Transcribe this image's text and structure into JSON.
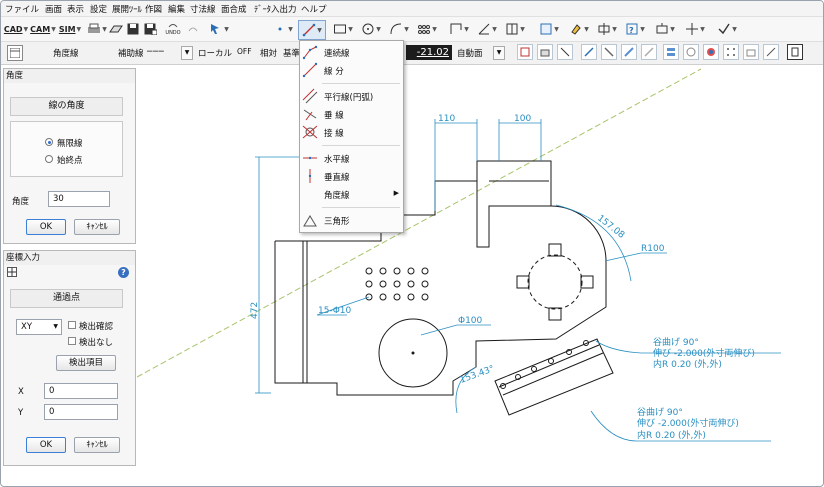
{
  "menubar": {
    "items": [
      "ファイル",
      "画面",
      "表示",
      "設定",
      "展開ﾂｰﾙ",
      "作図",
      "編集",
      "寸法線",
      "面合成",
      "ﾃﾞｰﾀ入出力",
      "ヘルプ"
    ]
  },
  "toolbar1": {
    "cad_label": "CAD",
    "cam_label": "CAM",
    "sim_label": "SIM",
    "undo_label": "UNDO"
  },
  "toolbar2": {
    "view_label": "角度線",
    "line_type": "補助線",
    "coord_system": "ローカル",
    "snap_state": "OFF",
    "relative_label": "相対",
    "base_label": "基準",
    "dimension_value": "-21.02",
    "plane_label": "自動面"
  },
  "line_menu": {
    "items": [
      {
        "label": "連続線",
        "icon": "polyline-icon"
      },
      {
        "label": "線 分",
        "icon": "segment-icon"
      },
      {
        "label": "平行線(円弧)",
        "icon": "parallel-line-icon"
      },
      {
        "label": "垂 線",
        "icon": "perpendicular-icon"
      },
      {
        "label": "接 線",
        "icon": "tangent-icon"
      },
      {
        "label": "水平線",
        "icon": "horizontal-line-icon"
      },
      {
        "label": "垂直線",
        "icon": "vertical-line-icon"
      },
      {
        "label": "角度線",
        "icon": "angle-line-icon",
        "has_submenu": true
      },
      {
        "label": "三角形",
        "icon": "triangle-icon"
      }
    ]
  },
  "angle_panel": {
    "title": "角度",
    "header": "線の角度",
    "option_infinite": "無限線",
    "option_endpoint": "始終点",
    "selected_option": "無限線",
    "angle_label": "角度",
    "angle_value": "30",
    "ok_label": "OK",
    "cancel_label": "ｷｬﾝｾﾙ"
  },
  "coord_panel": {
    "title": "座標入力",
    "help_label": "?",
    "passpoint_label": "通過点",
    "mode_value": "XY",
    "check_confirm": "検出確認",
    "check_none": "検出なし",
    "detect_button": "検出項目",
    "x_label": "X",
    "x_value": "0",
    "y_label": "Y",
    "y_value": "0",
    "ok_label": "OK",
    "cancel_label": "ｷｬﾝｾﾙ"
  },
  "drawing": {
    "dims": {
      "dim_110": "110",
      "dim_100": "100",
      "dim_472": "472",
      "dim_157": "157.08",
      "radius": "R100",
      "holes": "15-Φ10",
      "circle": "Φ100",
      "angle": "153.43°"
    },
    "note1": {
      "line1": "谷曲げ 90°",
      "line2": "伸び -2.000(外寸両伸び)",
      "line3": "内R  0.20 (外,外)"
    },
    "note2": {
      "line1": "谷曲げ 90°",
      "line2": "伸び -2.000(外寸両伸び)",
      "line3": "内R  0.20 (外,外)"
    }
  },
  "colors": {
    "dimension": "#2a8fc2",
    "outline": "#1a1a1a",
    "guide_line": "#a8c36a",
    "accent_dark": "#1c1c1c"
  }
}
